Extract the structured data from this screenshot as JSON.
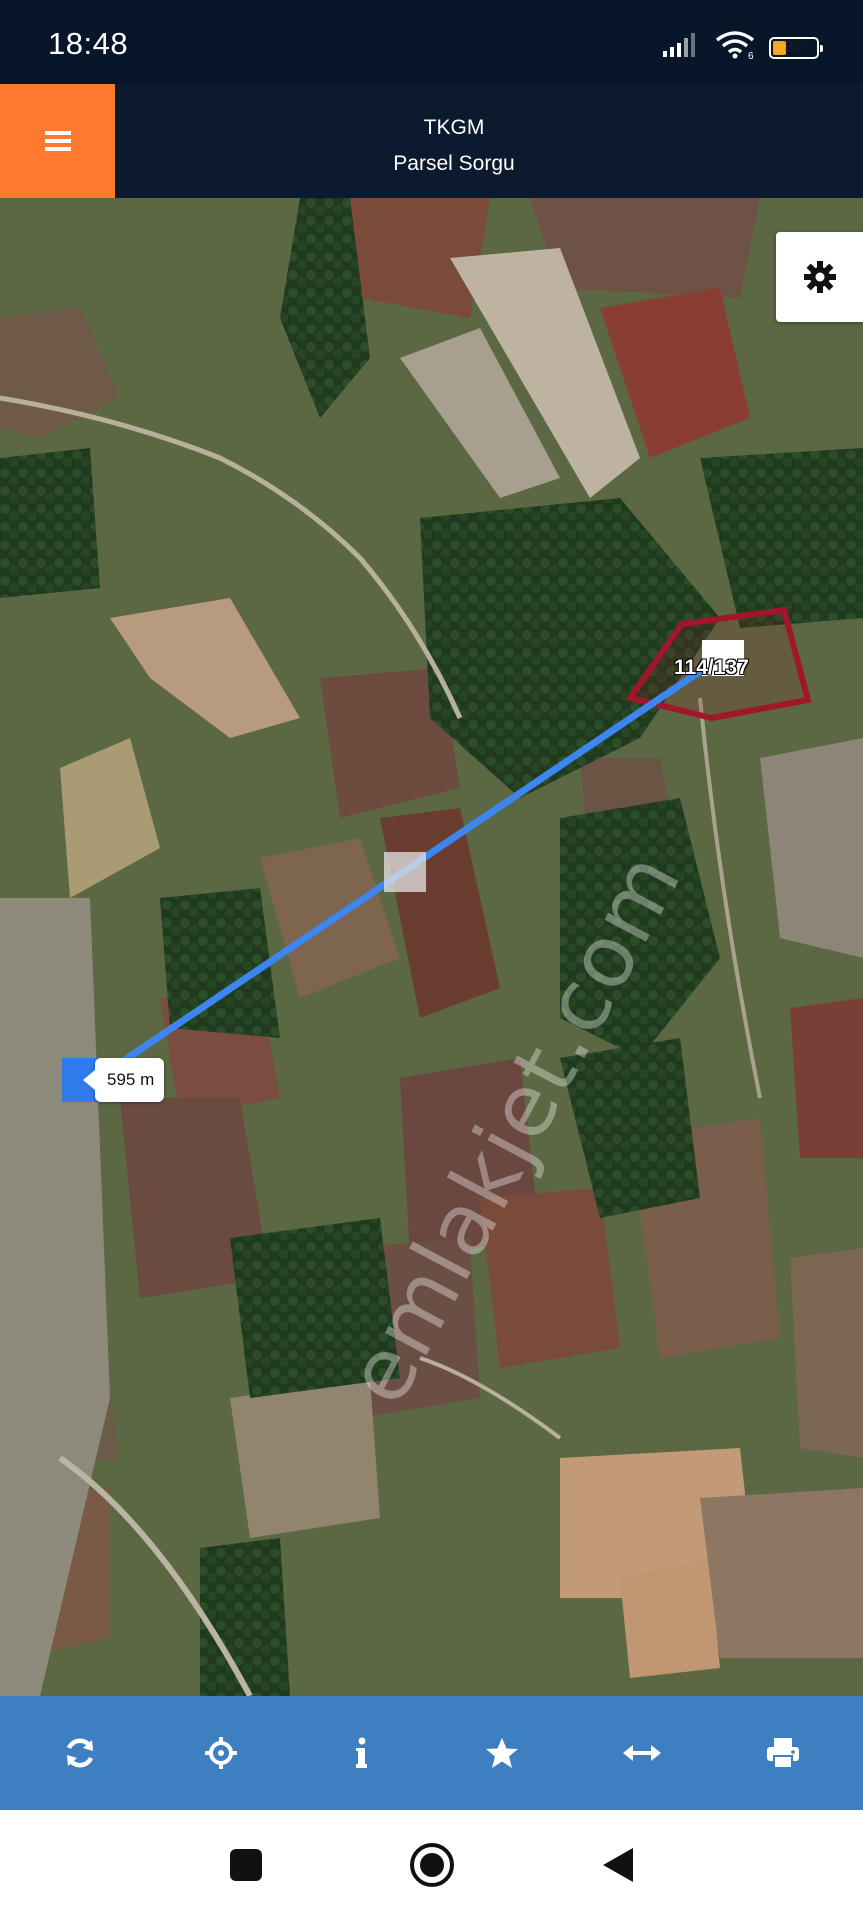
{
  "status_bar": {
    "time": "18:48",
    "battery_level": "37",
    "icons": [
      "signal-icon",
      "wifi-icon",
      "battery-icon"
    ]
  },
  "header": {
    "title": "TKGM",
    "subtitle": "Parsel Sorgu",
    "menu_icon": "hamburger-menu-icon"
  },
  "map": {
    "settings_icon": "gear-icon",
    "parcel_label": "114/137",
    "distance_label": "595 m",
    "watermark": "emlakjet.com",
    "parcel_outline_color": "#a0162b",
    "measure_line_color": "#3d86f0"
  },
  "toolbar": {
    "color": "#3d7fc1",
    "buttons": [
      {
        "icon": "refresh-icon"
      },
      {
        "icon": "crosshair-locate-icon"
      },
      {
        "icon": "info-icon"
      },
      {
        "icon": "star-favorite-icon"
      },
      {
        "icon": "measure-distance-icon"
      },
      {
        "icon": "print-icon"
      }
    ]
  },
  "nav_bar": {
    "buttons": [
      "recents-square-icon",
      "home-circle-icon",
      "back-triangle-icon"
    ]
  },
  "colors": {
    "accent_orange": "#ff7a2f",
    "header_bg": "#0b1a2e",
    "status_bg": "#071629"
  }
}
